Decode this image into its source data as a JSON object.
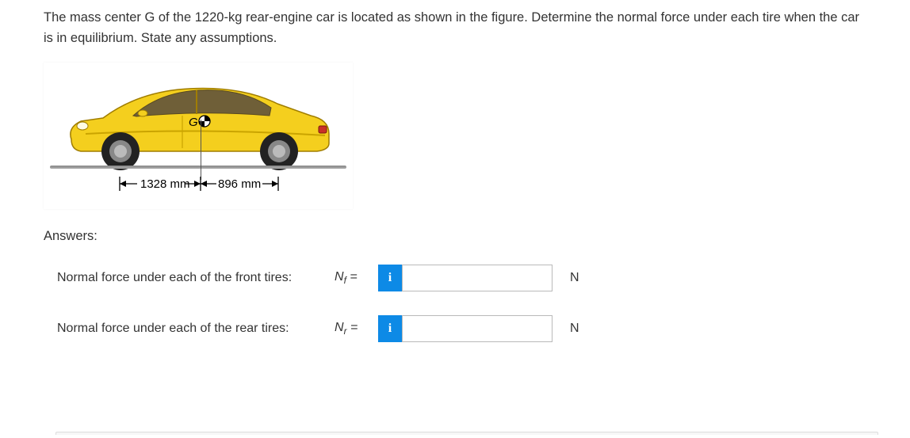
{
  "question": "The mass center G of the 1220-kg rear-engine car is located as shown in the figure. Determine the normal force under each tire when the car is in equilibrium. State any assumptions.",
  "figure": {
    "g_label": "G",
    "dim_front": "1328 mm",
    "dim_rear": "896 mm"
  },
  "answers_heading": "Answers:",
  "rows": [
    {
      "label": "Normal force under each of the front tires:",
      "symbol_html": "N<sub>f</sub> =",
      "info": "i",
      "value": "",
      "unit": "N"
    },
    {
      "label": "Normal force under each of the rear tires:",
      "symbol_html": "N<sub>r</sub> =",
      "info": "i",
      "value": "",
      "unit": "N"
    }
  ]
}
